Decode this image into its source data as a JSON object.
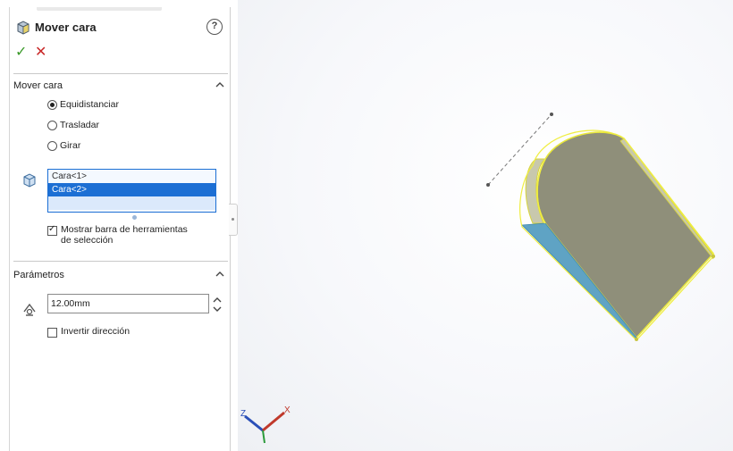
{
  "property_manager": {
    "title": "Mover cara",
    "help_label": "?",
    "ok_label": "✓",
    "cancel_label": "✕"
  },
  "move_face_group": {
    "header": "Mover cara",
    "options": [
      {
        "label": "Equidistanciar",
        "selected": true
      },
      {
        "label": "Trasladar",
        "selected": false
      },
      {
        "label": "Girar",
        "selected": false
      }
    ],
    "faces": [
      "Cara<1>",
      "Cara<2>"
    ],
    "selected_face_index": 1,
    "show_toolbar": {
      "line1": "Mostrar barra de herramientas",
      "line2": "de selección",
      "checked": true
    }
  },
  "parameters_group": {
    "header": "Parámetros",
    "distance_value": "12.00mm",
    "reverse_direction": {
      "label": "Invertir dirección",
      "checked": false
    }
  },
  "triad_axes": {
    "z": "Z",
    "x": "X"
  },
  "colors": {
    "selection_blue": "#1c6fd4",
    "ok_green": "#3c9a2b",
    "cancel_red": "#c92a2a",
    "face_highlight": "#e9e83a",
    "model_gray": "#8f8f7a"
  }
}
